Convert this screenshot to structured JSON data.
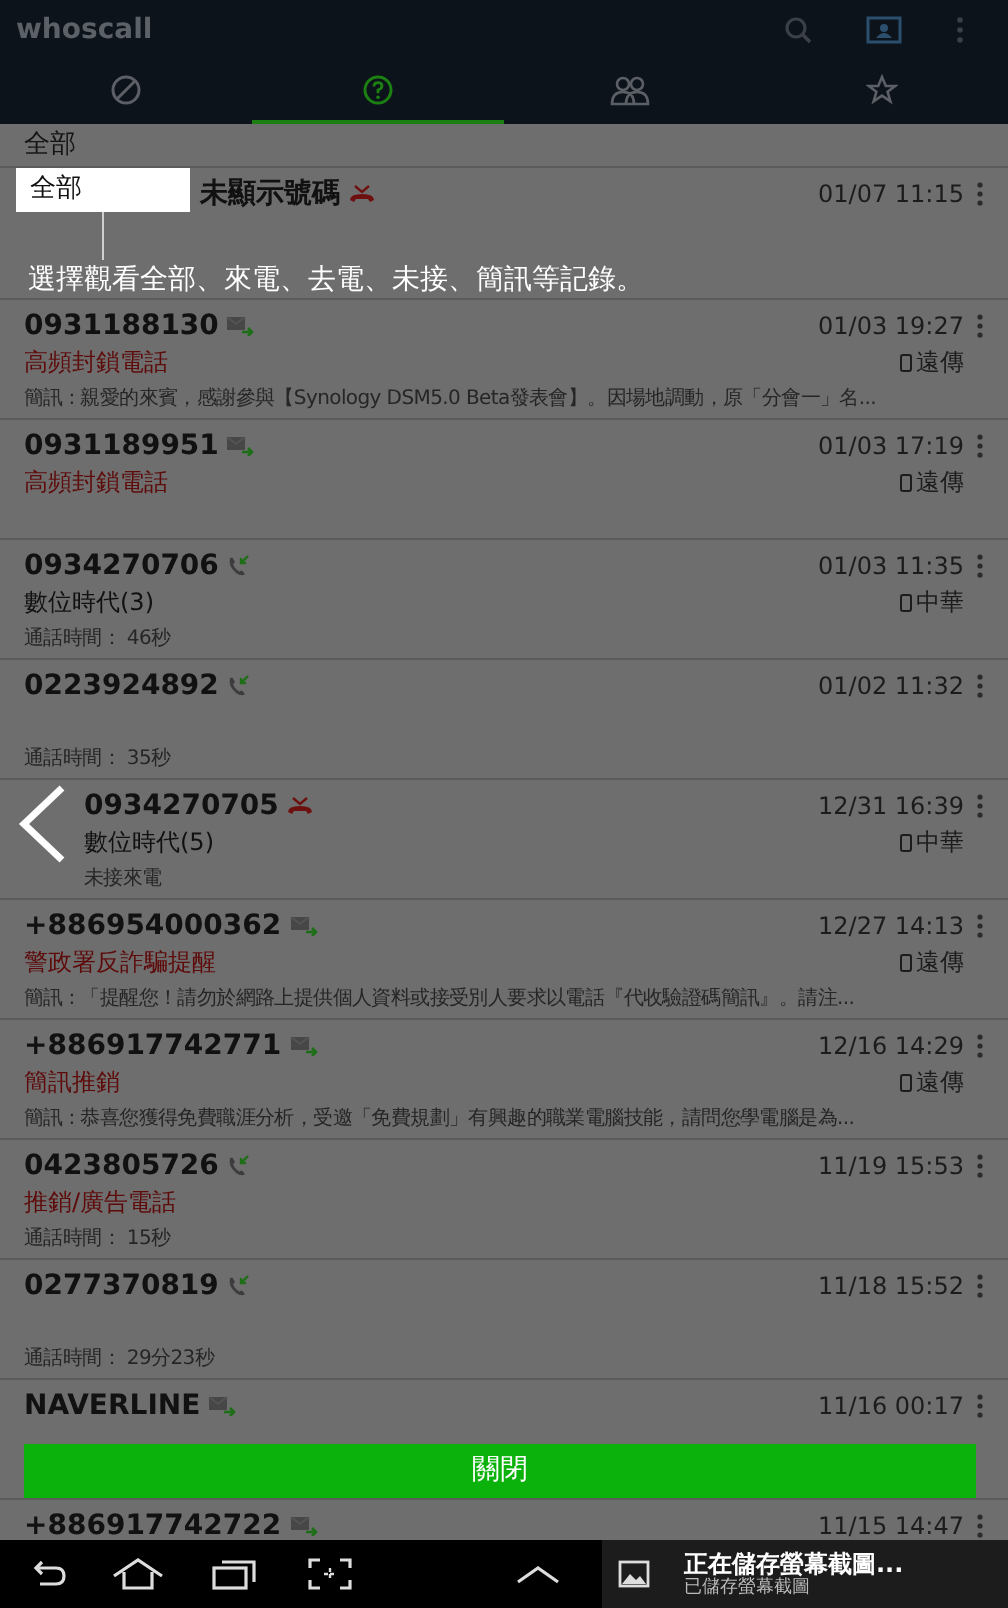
{
  "app_bar": {
    "title": "whoscall"
  },
  "tabs": [
    {
      "selected": false
    },
    {
      "selected": true
    },
    {
      "selected": false
    },
    {
      "selected": false
    }
  ],
  "filter": {
    "label": "全部"
  },
  "rows": [
    {
      "kind": "missed",
      "number": "未顯示號碼",
      "time": "01/07 11:15"
    },
    {
      "kind": "sms",
      "number": "0931188130",
      "time": "01/03 19:27",
      "label": {
        "text": "高頻封鎖電話",
        "color": "#5e0a0a"
      },
      "carrier": "遠傳",
      "detail": "簡訊 : 親愛的來賓，感謝參與【Synology DSM5.0 Beta發表會】。因場地調動，原「分會一」名..."
    },
    {
      "kind": "sms",
      "number": "0931189951",
      "time": "01/03 17:19",
      "label": {
        "text": "高頻封鎖電話",
        "color": "#5e0a0a"
      },
      "carrier": "遠傳"
    },
    {
      "kind": "call",
      "number": "0934270706",
      "time": "01/03 11:35",
      "label": {
        "text": "數位時代(3)",
        "color": "#111111"
      },
      "carrier": "中華",
      "detail": "通話時間： 46秒"
    },
    {
      "kind": "call",
      "number": "0223924892",
      "time": "01/02 11:32",
      "detail": "通話時間： 35秒"
    },
    {
      "kind": "missed",
      "number": "0934270705",
      "time": "12/31 16:39",
      "label": {
        "text": "數位時代(5)",
        "color": "#111111"
      },
      "carrier": "中華",
      "detail": "未接來電"
    },
    {
      "kind": "sms",
      "number": "+886954000362",
      "time": "12/27 14:13",
      "label": {
        "text": "警政署反詐騙提醒",
        "color": "#5e0a0a"
      },
      "carrier": "遠傳",
      "detail": "簡訊 : 「提醒您！請勿於網路上提供個人資料或接受別人要求以電話『代收驗證碼簡訊』。請注..."
    },
    {
      "kind": "sms",
      "number": "+886917742771",
      "time": "12/16 14:29",
      "label": {
        "text": "簡訊推銷",
        "color": "#5e0a0a"
      },
      "carrier": "遠傳",
      "detail": "簡訊 : 恭喜您獲得免費職涯分析，受邀「免費規劃」有興趣的職業電腦技能，請問您學電腦是為..."
    },
    {
      "kind": "call",
      "number": "0423805726",
      "time": "11/19 15:53",
      "label": {
        "text": "推銷/廣告電話",
        "color": "#5e0a0a"
      },
      "detail": "通話時間： 15秒"
    },
    {
      "kind": "call",
      "number": "0277370819",
      "time": "11/18 15:52",
      "detail": "通話時間： 29分23秒"
    },
    {
      "kind": "sms",
      "number": "NAVERLINE",
      "time": "11/16 00:17"
    }
  ],
  "peek_row": {
    "kind": "sms",
    "number": "+886917742722",
    "time": "11/15 14:47"
  },
  "tutorial": {
    "callout": "全部",
    "text": "選擇觀看全部、來電、去電、未接、簡訊等記錄。",
    "close_button": "關閉"
  },
  "notification": {
    "title": "正在儲存螢幕截圖...",
    "subtitle": "已儲存螢幕截圖"
  }
}
